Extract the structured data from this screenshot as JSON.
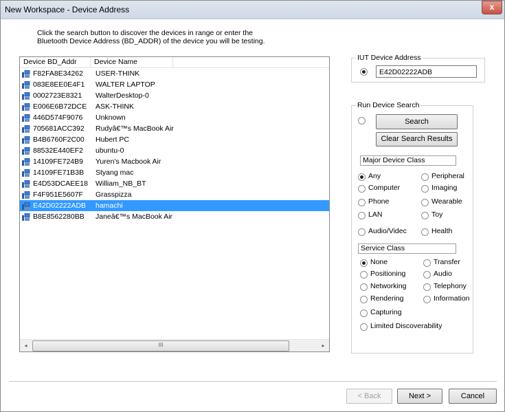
{
  "window": {
    "title": "New Workspace - Device Address",
    "close_glyph": "x"
  },
  "intro_text": "Click the search button to discover the devices in range or enter the Bluetooth Device Address (BD_ADDR) of the device you will be testing.",
  "device_list": {
    "columns": [
      "Device BD_Addr",
      "Device Name"
    ],
    "rows": [
      {
        "addr": "F82FA8E34262",
        "name": "USER-THINK"
      },
      {
        "addr": "083E8EE0E4F1",
        "name": "WALTER LAPTOP"
      },
      {
        "addr": "0002723E8321",
        "name": "WalterDesktop-0"
      },
      {
        "addr": "E006E6B72DCE",
        "name": "ASK-THINK"
      },
      {
        "addr": "446D574F9076",
        "name": "Unknown"
      },
      {
        "addr": "705681ACC392",
        "name": "Rudyâ€™s MacBook Air"
      },
      {
        "addr": "B4B6760F2C00",
        "name": "Hubert PC"
      },
      {
        "addr": "88532E440EF2",
        "name": "ubuntu-0"
      },
      {
        "addr": "14109FE724B9",
        "name": "Yuren's Macbook Air"
      },
      {
        "addr": "14109FE71B3B",
        "name": "Styang mac"
      },
      {
        "addr": "E4D53DCAEE18",
        "name": "William_NB_BT"
      },
      {
        "addr": "F4F951E5607F",
        "name": "Grasspizza"
      },
      {
        "addr": "E42D02222ADB",
        "name": "hamachi",
        "selected": true
      },
      {
        "addr": "B8E8562280BB",
        "name": "Janeâ€™s MacBook Air"
      }
    ],
    "scroll": {
      "left_glyph": "◂",
      "right_glyph": "▸",
      "thumb_glyph": "III"
    }
  },
  "iut": {
    "legend": "IUT Device Address",
    "value": "E42D02222ADB"
  },
  "run_search": {
    "legend": "Run Device Search",
    "search_label": "Search",
    "clear_label": "Clear Search Results",
    "major_class": {
      "header": "Major Device Class",
      "options": [
        "Any",
        "Peripheral",
        "Computer",
        "Imaging",
        "Phone",
        "Wearable",
        "LAN",
        "Toy",
        "Audio/Videc",
        "Health"
      ],
      "selected": "Any"
    },
    "service_class": {
      "header": "Service Class",
      "options": [
        "None",
        "Transfer",
        "Positioning",
        "Audio",
        "Networking",
        "Telephony",
        "Rendering",
        "Information",
        "Capturing",
        "Limited Discoverability"
      ],
      "selected": "None"
    }
  },
  "footer": {
    "back_label": "< Back",
    "next_label": "Next >",
    "cancel_label": "Cancel"
  },
  "colors": {
    "selection": "#3399ff",
    "title_bar": "#cfd9e6",
    "close": "#c75246"
  }
}
